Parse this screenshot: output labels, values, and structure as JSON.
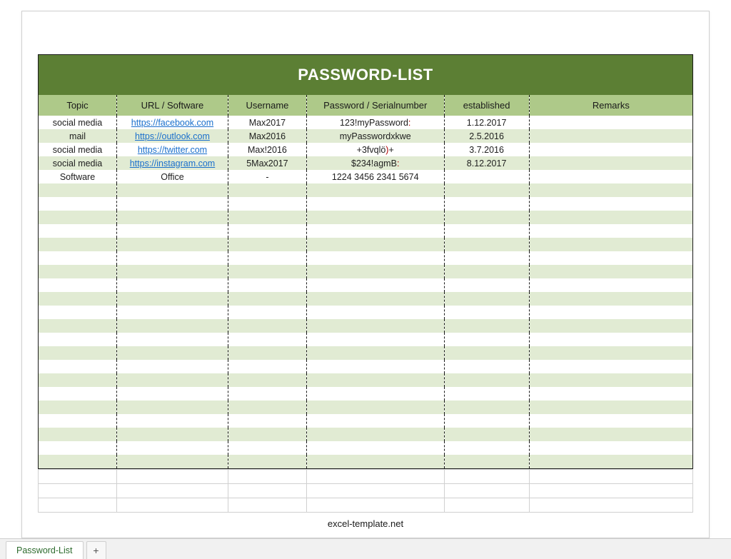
{
  "title": "PASSWORD-LIST",
  "columns": [
    "Topic",
    "URL / Software",
    "Username",
    "Password / Serialnumber",
    "established",
    "Remarks"
  ],
  "rows": [
    {
      "topic": "social media",
      "url": "https://facebook.com",
      "url_is_link": true,
      "user": "Max2017",
      "pw_pre": "123!myPassword",
      "pw_sym": ":",
      "pw_post": "",
      "date": "1.12.2017",
      "remarks": ""
    },
    {
      "topic": "mail",
      "url": "https://outlook.com",
      "url_is_link": true,
      "user": "Max2016",
      "pw_pre": "myPasswordxkwe",
      "pw_sym": "",
      "pw_post": "",
      "date": "2.5.2016",
      "remarks": ""
    },
    {
      "topic": "social media",
      "url": "https://twitter.com",
      "url_is_link": true,
      "user": "Max!2016",
      "pw_pre": "+3fvqlö",
      "pw_sym": ")",
      "pw_post": "+",
      "date": "3.7.2016",
      "remarks": ""
    },
    {
      "topic": "social media",
      "url": "https://instagram.com",
      "url_is_link": true,
      "user": "5Max2017",
      "pw_pre": "$234!agmB",
      "pw_sym": ":",
      "pw_post": "",
      "date": "8.12.2017",
      "remarks": ""
    },
    {
      "topic": "Software",
      "url": "Office",
      "url_is_link": false,
      "user": "-",
      "pw_pre": "1224 3456 2341 5674",
      "pw_sym": "",
      "pw_post": "",
      "date": "",
      "remarks": ""
    }
  ],
  "blank_rows": 21,
  "footer": "excel-template.net",
  "tabs": {
    "active": "Password-List",
    "add": "+"
  }
}
